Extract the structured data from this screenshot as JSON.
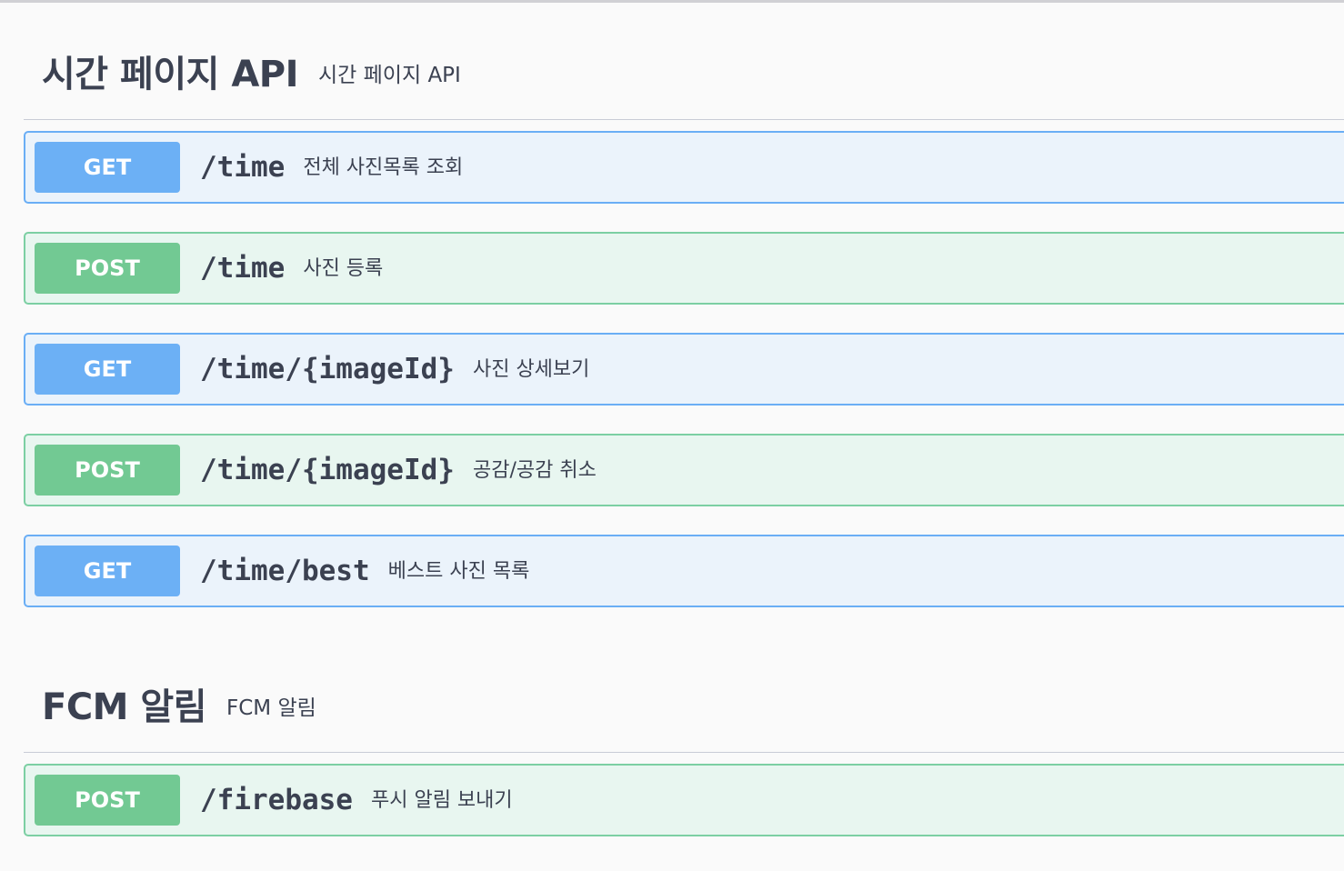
{
  "sections": [
    {
      "title": "시간 페이지 API",
      "description": "시간 페이지 API",
      "operations": [
        {
          "method": "GET",
          "path": "/time",
          "summary": "전체 사진목록 조회"
        },
        {
          "method": "POST",
          "path": "/time",
          "summary": "사진 등록"
        },
        {
          "method": "GET",
          "path": "/time/{imageId}",
          "summary": "사진 상세보기"
        },
        {
          "method": "POST",
          "path": "/time/{imageId}",
          "summary": "공감/공감 취소"
        },
        {
          "method": "GET",
          "path": "/time/best",
          "summary": "베스트 사진 목록"
        }
      ]
    },
    {
      "title": "FCM 알림",
      "description": "FCM 알림",
      "operations": [
        {
          "method": "POST",
          "path": "/firebase",
          "summary": "푸시 알림 보내기"
        }
      ]
    }
  ],
  "colors": {
    "get_accent": "#61affe",
    "post_accent": "#49cc90",
    "get_bg": "#ebf3fb",
    "post_bg": "#e8f6f0",
    "text": "#3b4151"
  }
}
